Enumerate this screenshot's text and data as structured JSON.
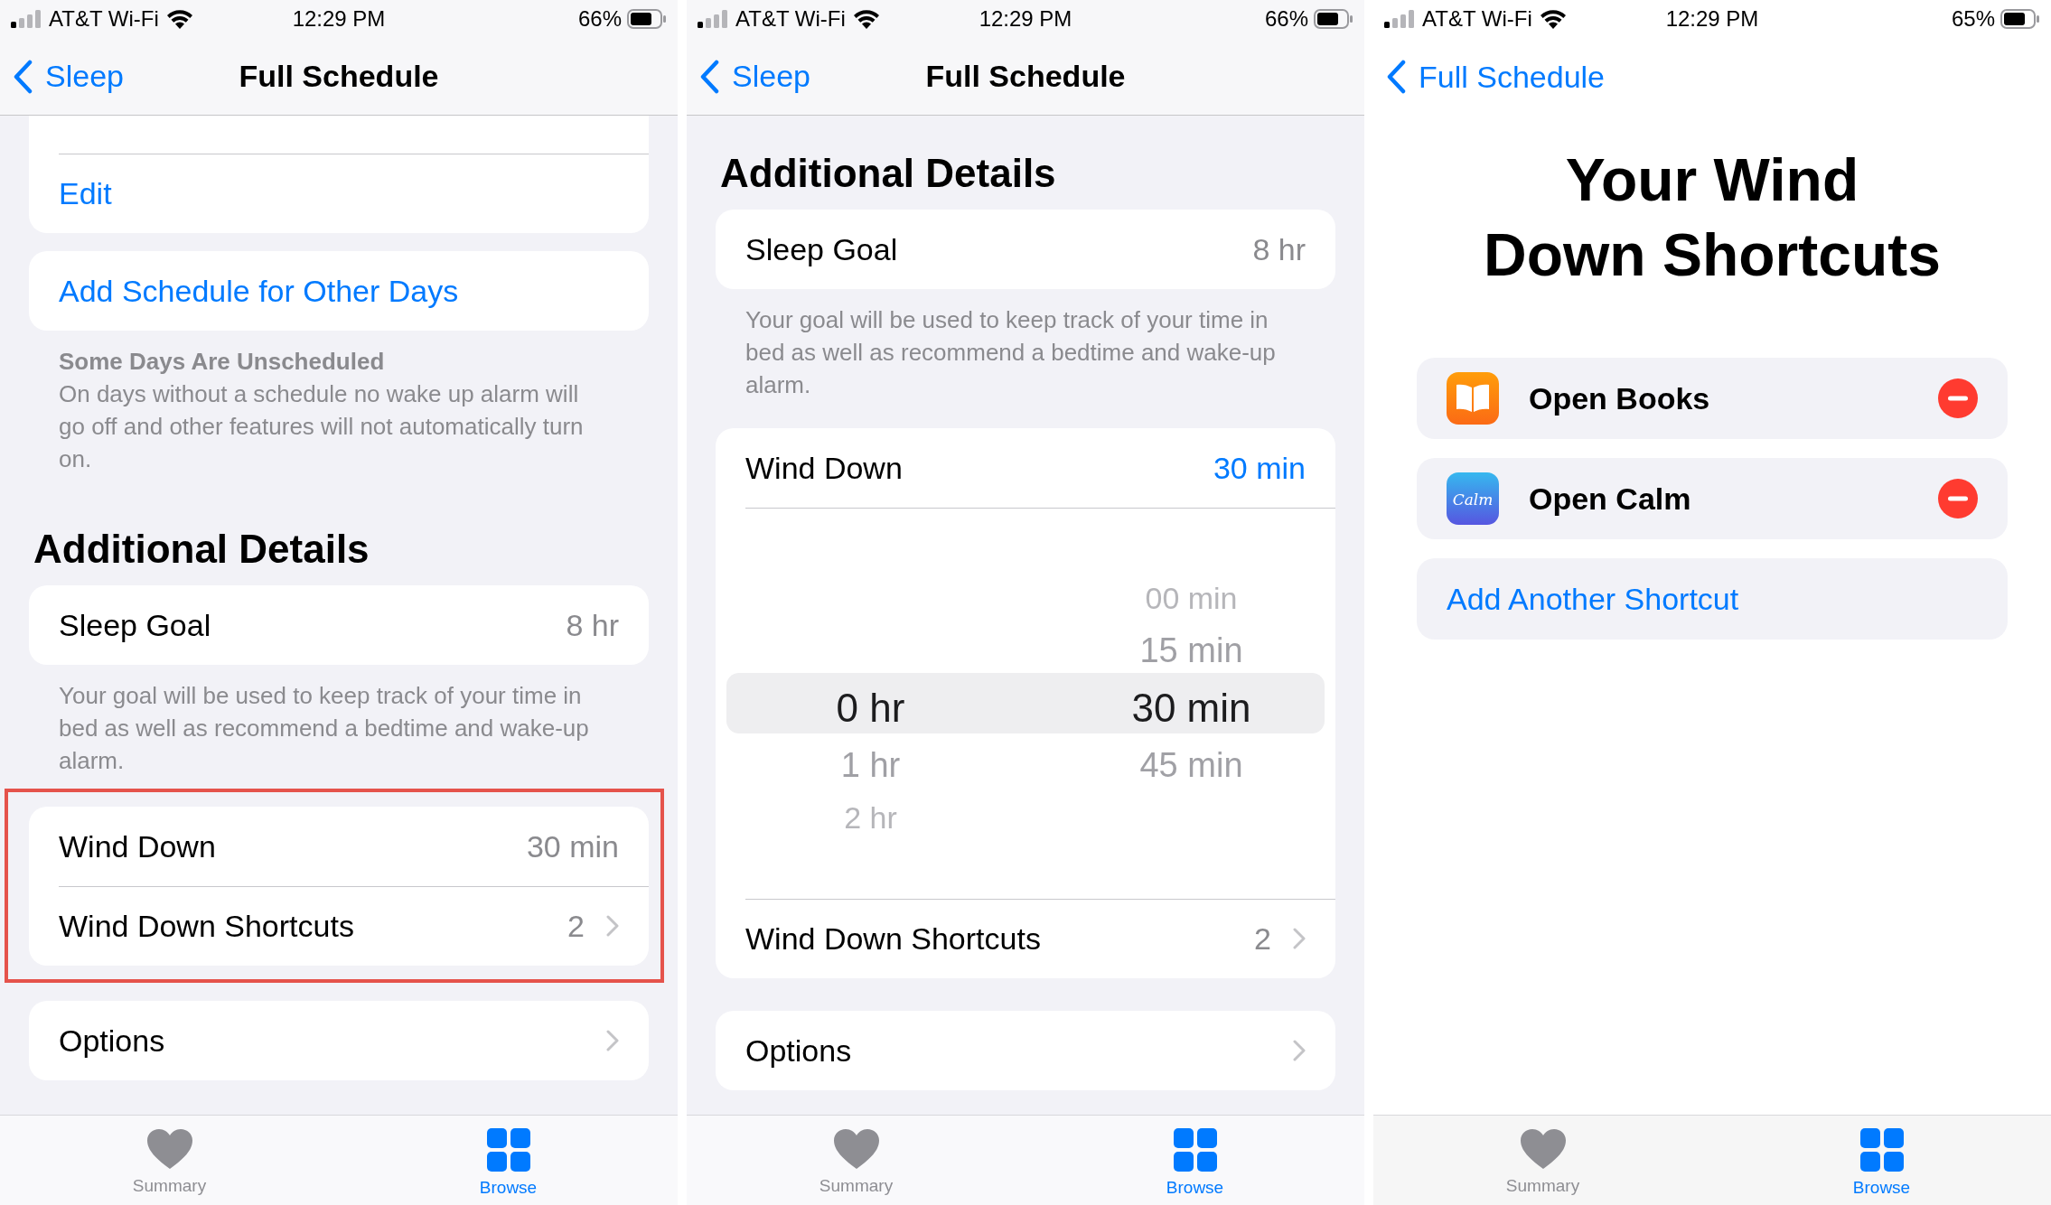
{
  "screens": [
    {
      "kind": "settings",
      "status_bar": {
        "carrier": "AT&T Wi-Fi",
        "time": "12:29 PM",
        "battery": "66%"
      },
      "nav": {
        "back": "Sleep",
        "title": "Full Schedule"
      },
      "blocks": [
        {
          "kind": "card",
          "clipped_top": true,
          "rows": [
            {
              "kind": "link",
              "label": "Edit"
            }
          ]
        },
        {
          "kind": "card",
          "rows": [
            {
              "kind": "link",
              "label": "Add Schedule for Other Days"
            }
          ]
        },
        {
          "kind": "footer",
          "title": "Some Days Are Unscheduled",
          "text": "On days without a schedule no wake up alarm will go off and other features will not automatically turn on."
        },
        {
          "kind": "header",
          "text": "Additional Details"
        },
        {
          "kind": "card",
          "rows": [
            {
              "kind": "value",
              "label": "Sleep Goal",
              "value": "8 hr",
              "active": false
            }
          ]
        },
        {
          "kind": "footer",
          "text": "Your goal will be used to keep track of your time in bed as well as recommend a bedtime and wake-up alarm."
        },
        {
          "kind": "card",
          "highlighted": true,
          "rows": [
            {
              "kind": "value",
              "label": "Wind Down",
              "value": "30 min",
              "active": false
            },
            {
              "kind": "disclosure",
              "label": "Wind Down Shortcuts",
              "value": "2"
            }
          ]
        },
        {
          "kind": "card",
          "rows": [
            {
              "kind": "disclosure",
              "label": "Options"
            }
          ]
        }
      ],
      "tab_bar": [
        {
          "label": "Summary",
          "selected": false
        },
        {
          "label": "Browse",
          "selected": true
        }
      ]
    },
    {
      "kind": "settings",
      "status_bar": {
        "carrier": "AT&T Wi-Fi",
        "time": "12:29 PM",
        "battery": "66%"
      },
      "nav": {
        "back": "Sleep",
        "title": "Full Schedule"
      },
      "blocks": [
        {
          "kind": "header",
          "text": "Additional Details"
        },
        {
          "kind": "card",
          "rows": [
            {
              "kind": "value",
              "label": "Sleep Goal",
              "value": "8 hr",
              "active": false
            }
          ]
        },
        {
          "kind": "footer",
          "text": "Your goal will be used to keep track of your time in bed as well as recommend a bedtime and wake-up alarm."
        },
        {
          "kind": "card",
          "rows": [
            {
              "kind": "value",
              "label": "Wind Down",
              "value": "30 min",
              "active": true
            },
            {
              "kind": "picker",
              "columns": [
                {
                  "items": [
                    {
                      "label": "0 hr",
                      "selected": true
                    },
                    {
                      "label": "1 hr",
                      "selected": false
                    },
                    {
                      "label": "2 hr",
                      "selected": false
                    }
                  ]
                },
                {
                  "items": [
                    {
                      "label": "00 min",
                      "selected": false
                    },
                    {
                      "label": "15 min",
                      "selected": false
                    },
                    {
                      "label": "30 min",
                      "selected": true
                    },
                    {
                      "label": "45 min",
                      "selected": false
                    }
                  ]
                }
              ]
            },
            {
              "kind": "disclosure",
              "label": "Wind Down Shortcuts",
              "value": "2"
            }
          ]
        },
        {
          "kind": "card",
          "rows": [
            {
              "kind": "disclosure",
              "label": "Options"
            }
          ]
        }
      ],
      "tab_bar": [
        {
          "label": "Summary",
          "selected": false
        },
        {
          "label": "Browse",
          "selected": true
        }
      ]
    },
    {
      "kind": "list",
      "status_bar": {
        "carrier": "AT&T Wi-Fi",
        "time": "12:29 PM",
        "battery": "65%"
      },
      "nav": {
        "back": "Full Schedule"
      },
      "blocks": [
        {
          "kind": "title",
          "text": "Your Wind Down Shortcuts"
        },
        {
          "kind": "card",
          "rows": [
            {
              "kind": "books",
              "label": "Open Books",
              "removable": true
            }
          ]
        },
        {
          "kind": "card",
          "rows": [
            {
              "kind": "calm",
              "icon_text": "Calm",
              "label": "Open Calm",
              "removable": true
            }
          ]
        },
        {
          "kind": "card",
          "rows": [
            {
              "kind": "link",
              "label": "Add Another Shortcut"
            }
          ]
        }
      ],
      "tab_bar": [
        {
          "label": "Summary",
          "selected": false
        },
        {
          "label": "Browse",
          "selected": true
        }
      ]
    }
  ]
}
